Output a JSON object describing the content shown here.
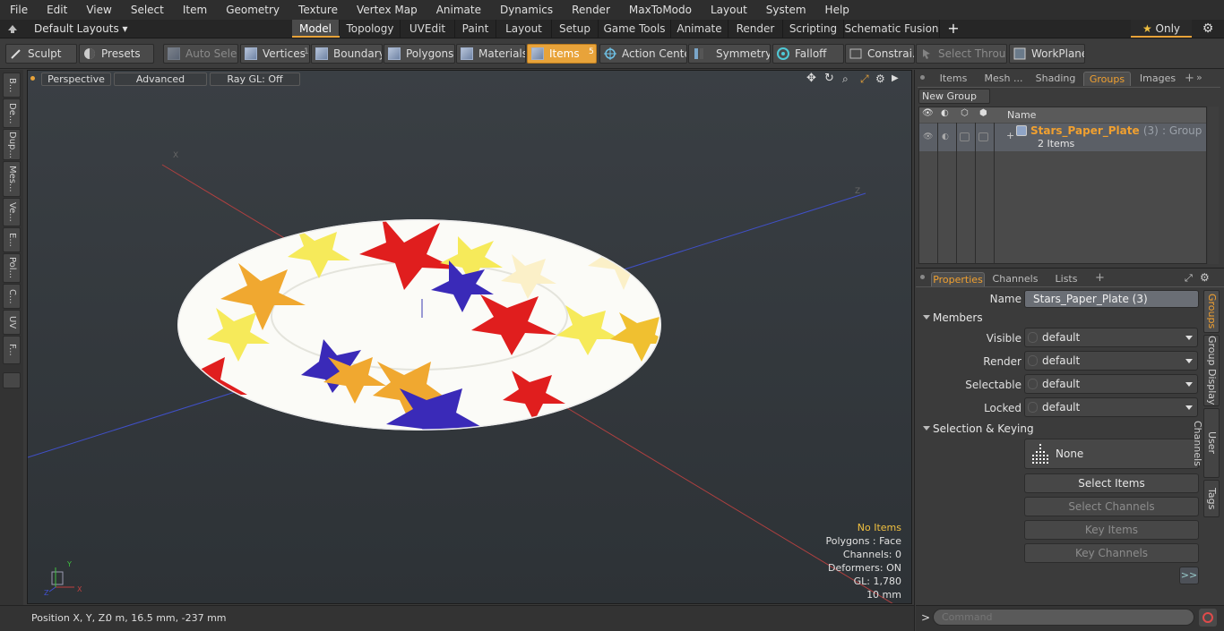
{
  "menu": [
    "File",
    "Edit",
    "View",
    "Select",
    "Item",
    "Geometry",
    "Texture",
    "Vertex Map",
    "Animate",
    "Dynamics",
    "Render",
    "MaxToModo",
    "Layout",
    "System",
    "Help"
  ],
  "layouts": {
    "default_label": "Default Layouts",
    "tabs": [
      "Model",
      "Topology",
      "UVEdit",
      "Paint",
      "Layout",
      "Setup",
      "Game Tools",
      "Animate",
      "Render",
      "Scripting",
      "Schematic Fusion"
    ],
    "active_tab": "Model",
    "plus": "+",
    "only_label": "Only"
  },
  "toolbar": {
    "sculpt": "Sculpt",
    "presets": "Presets",
    "auto_select": "Auto Select",
    "vertices": "Vertices",
    "vertices_count": "1",
    "boundary": "Boundary",
    "polygons": "Polygons",
    "materials": "Materials",
    "items": "Items",
    "items_count": "5",
    "action_center": "Action Center",
    "symmetry": "Symmetry",
    "falloff": "Falloff",
    "constraints": "Constrai...",
    "select_through": "Select Through",
    "workplane": "WorkPlane"
  },
  "left_tabs": [
    "B...",
    "De...",
    "Dup...",
    "Mes...",
    "Ve...",
    "E...",
    "Pol...",
    "C...",
    "UV",
    "F..."
  ],
  "viewport": {
    "view": "Perspective",
    "shading": "Advanced",
    "raygl": "Ray GL: Off",
    "info": {
      "no_items": "No Items",
      "polygons": "Polygons : Face",
      "channels": "Channels: 0",
      "deformers": "Deformers: ON",
      "gl": "GL: 1,780",
      "scale": "10 mm"
    },
    "axis_x": "X",
    "axis_y": "Y",
    "axis_z": "Z"
  },
  "status": {
    "position_label": "Position X, Y, Z:",
    "position_value": "0 m, 16.5 mm, -237 mm"
  },
  "right_top": {
    "tabs": [
      "Items",
      "Mesh ...",
      "Shading",
      "Groups",
      "Images"
    ],
    "active_tab": "Groups",
    "new_group": "New Group",
    "col_name": "Name",
    "group_name": "Stars_Paper_Plate",
    "group_count": "(3)",
    "group_type": ": Group",
    "group_items": "2 Items"
  },
  "properties": {
    "tabs": [
      "Properties",
      "Channels",
      "Lists"
    ],
    "active_tab": "Properties",
    "name_label": "Name",
    "name_value": "Stars_Paper_Plate (3)",
    "members_section": "Members",
    "visible_label": "Visible",
    "visible_value": "default",
    "render_label": "Render",
    "render_value": "default",
    "selectable_label": "Selectable",
    "selectable_value": "default",
    "locked_label": "Locked",
    "locked_value": "default",
    "selkey_section": "Selection & Keying",
    "none_label": "None",
    "select_items": "Select Items",
    "select_channels": "Select Channels",
    "key_items": "Key Items",
    "key_channels": "Key Channels",
    "more": ">>",
    "side_tabs": [
      "Groups",
      "Group Display",
      "User Channels",
      "Tags"
    ]
  },
  "command": {
    "prompt": ">",
    "placeholder": "Command"
  }
}
